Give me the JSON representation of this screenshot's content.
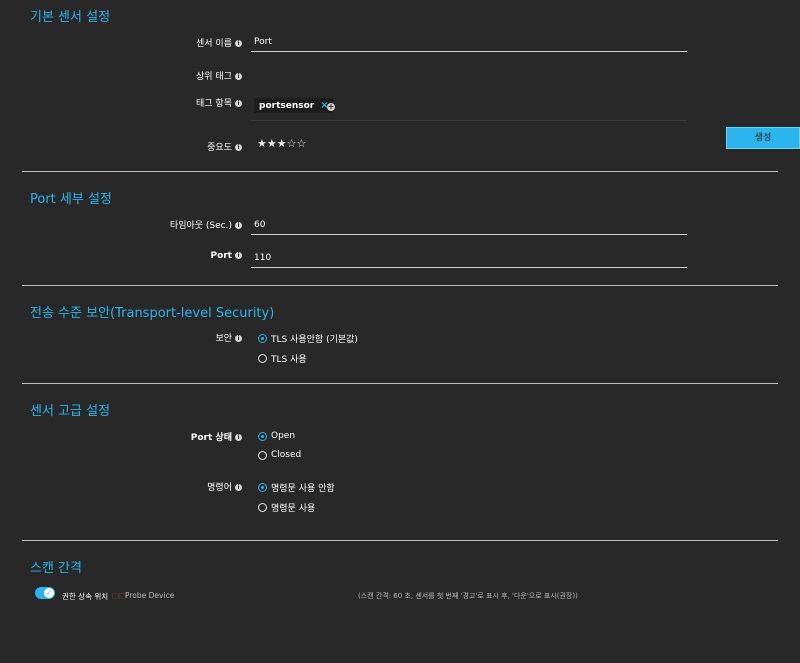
{
  "basic": {
    "title": "기본 센서 설정",
    "name_label": "센서 이름",
    "name_value": "Port",
    "parent_tags_label": "상위 태그",
    "tags_label": "태그 항목",
    "tag_chip": "portsensor",
    "tag_remove": "×",
    "tag_add": "+",
    "priority_label": "중요도",
    "priority_stars": "★★★☆☆",
    "priority_value": 3,
    "create_button": "생성"
  },
  "port": {
    "title": "Port 세부 설정",
    "timeout_label": "타임아웃 (Sec.)",
    "timeout_value": "60",
    "port_label": "Port",
    "port_value": "110"
  },
  "tls": {
    "title": "전송 수준 보안(Transport-level Security)",
    "security_label": "보안",
    "option_off": "TLS 사용안함 (기본값)",
    "option_on": "TLS 사용"
  },
  "advanced": {
    "title": "센서 고급 설정",
    "port_state_label": "Port 상태",
    "state_open": "Open",
    "state_closed": "Closed",
    "command_label": "명령어",
    "cmd_off": "명령문 사용 안함",
    "cmd_on": "명령문 사용"
  },
  "scan": {
    "title": "스캔 간격",
    "inherit_label": "권한 상속 위치",
    "probe_badge": "□□",
    "probe_device": "Probe Device",
    "interval_note": "(스캔 간격: 60 초, 센서를 첫 번째 '경고'로 표시 후, '다운'으로 표시(권장))"
  },
  "icons": {
    "info": "i",
    "check": "✓"
  },
  "colors": {
    "accent": "#2cb5ec",
    "background": "#282828"
  }
}
